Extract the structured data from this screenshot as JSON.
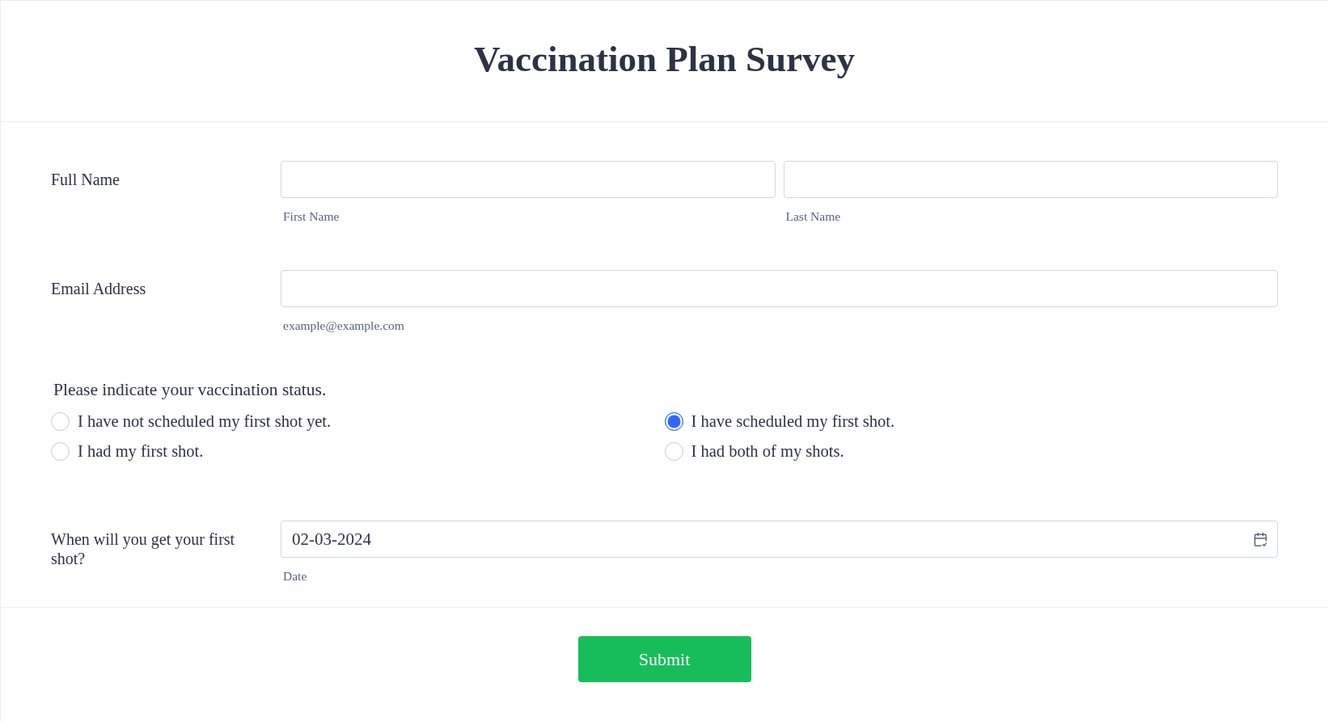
{
  "form": {
    "title": "Vaccination Plan Survey"
  },
  "fields": [
    {
      "kind": "name",
      "label": "Full Name",
      "inputs": [
        {
          "sublabel": "First Name"
        },
        {
          "sublabel": "Last Name"
        }
      ]
    },
    {
      "kind": "email",
      "label": "Email Address",
      "inputs": [
        {
          "sublabel": "example@example.com"
        }
      ]
    },
    {
      "kind": "radio",
      "question": "Please indicate your vaccination status.",
      "options": [
        {
          "label": "I have not scheduled my first shot yet.",
          "selected": false
        },
        {
          "label": "I have scheduled my first shot.",
          "selected": true
        },
        {
          "label": "I had my first shot.",
          "selected": false
        },
        {
          "label": "I had both of my shots.",
          "selected": false
        }
      ]
    },
    {
      "kind": "date",
      "label": "When will you get your first shot?",
      "inputs": [
        {
          "value": "02-03-2024",
          "sublabel": "Date"
        }
      ]
    }
  ],
  "submit": {
    "label": "Submit"
  }
}
